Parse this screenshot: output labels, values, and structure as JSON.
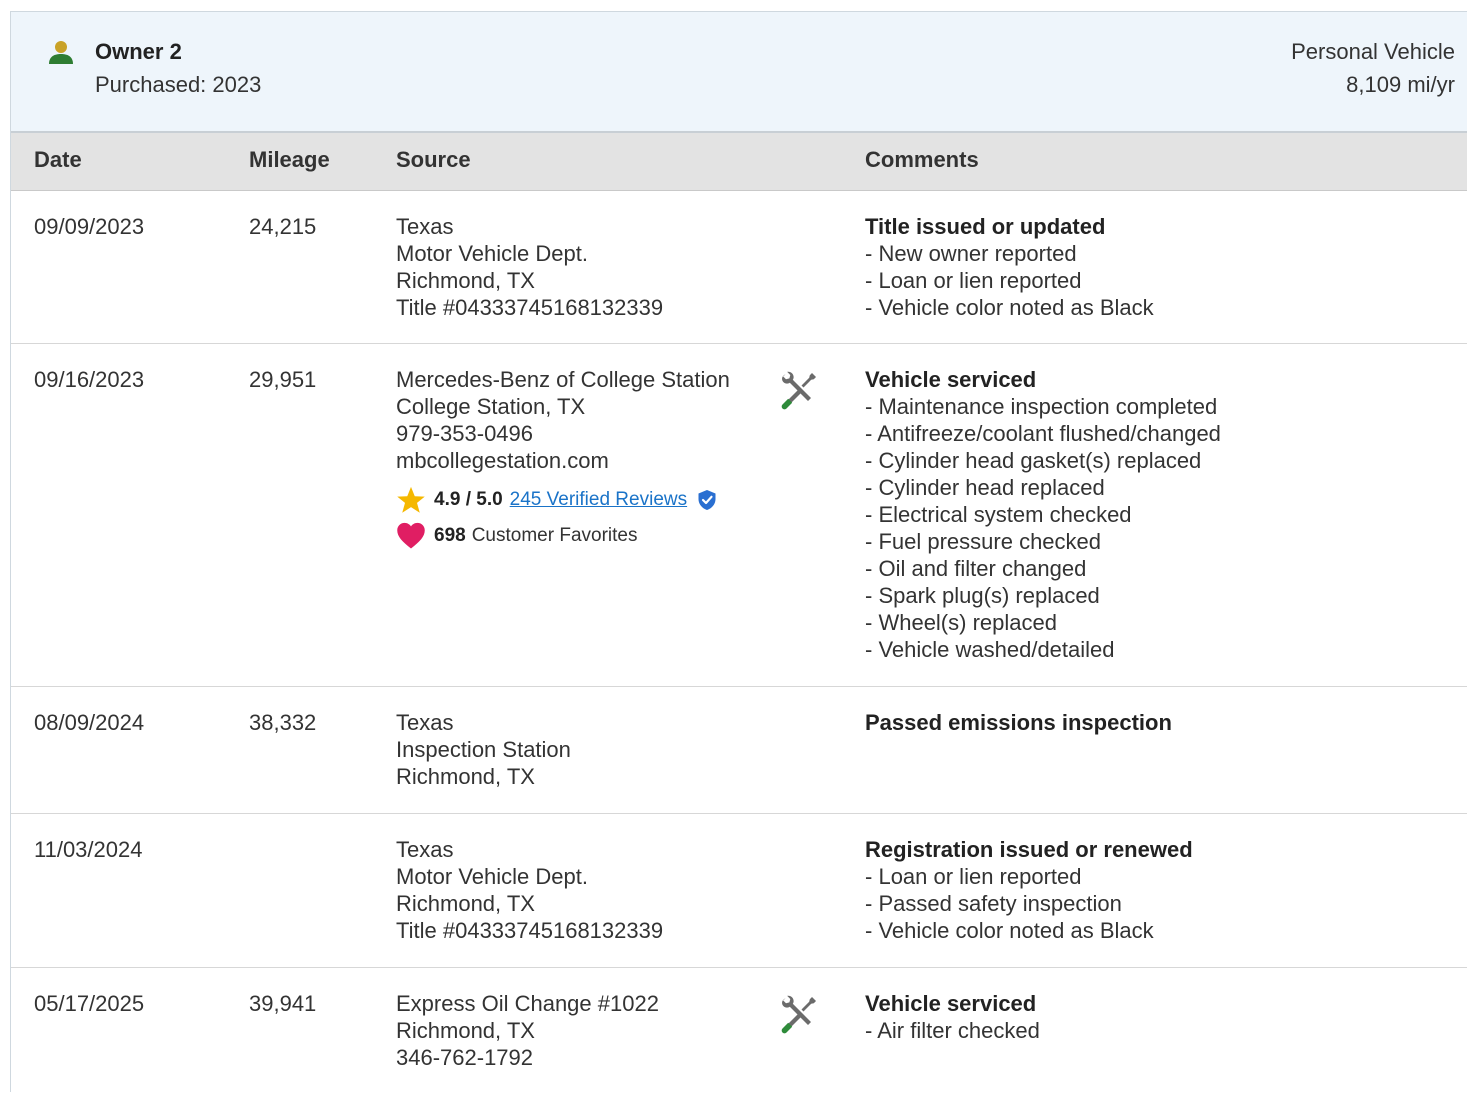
{
  "owner": {
    "name": "Owner 2",
    "purchased": "Purchased: 2023",
    "vehicle_type": "Personal Vehicle",
    "annual_miles": "8,109 mi/yr"
  },
  "columns": {
    "date": "Date",
    "mileage": "Mileage",
    "source": "Source",
    "comments": "Comments"
  },
  "records": [
    {
      "date": "09/09/2023",
      "mileage": "24,215",
      "source": [
        "Texas",
        "Motor Vehicle Dept.",
        "Richmond, TX",
        "Title #04333745168132339"
      ],
      "comment_title": "Title issued or updated",
      "comment_items": [
        "New owner reported",
        "Loan or lien reported",
        "Vehicle color noted as Black"
      ]
    },
    {
      "date": "09/16/2023",
      "mileage": "29,951",
      "source": [
        "Mercedes-Benz of College Station",
        "College Station, TX",
        "979-353-0496",
        "mbcollegestation.com"
      ],
      "rating": {
        "score": "4.9 / 5.0",
        "reviews_link": "245 Verified Reviews",
        "favorites_count": "698",
        "favorites_label": "Customer Favorites"
      },
      "comment_title": "Vehicle serviced",
      "comment_items": [
        "Maintenance inspection completed",
        "Antifreeze/coolant flushed/changed",
        "Cylinder head gasket(s) replaced",
        "Cylinder head replaced",
        "Electrical system checked",
        "Fuel pressure checked",
        "Oil and filter changed",
        "Spark plug(s) replaced",
        "Wheel(s) replaced",
        "Vehicle washed/detailed"
      ]
    },
    {
      "date": "08/09/2024",
      "mileage": "38,332",
      "source": [
        "Texas",
        "Inspection Station",
        "Richmond, TX"
      ],
      "comment_title": "Passed emissions inspection",
      "comment_items": []
    },
    {
      "date": "11/03/2024",
      "mileage": "",
      "source": [
        "Texas",
        "Motor Vehicle Dept.",
        "Richmond, TX",
        "Title #04333745168132339"
      ],
      "comment_title": "Registration issued or renewed",
      "comment_items": [
        "Loan or lien reported",
        "Passed safety inspection",
        "Vehicle color noted as Black"
      ]
    },
    {
      "date": "05/17/2025",
      "mileage": "39,941",
      "source": [
        "Express Oil Change #1022",
        "Richmond, TX",
        "346-762-1792"
      ],
      "comment_title": "Vehicle serviced",
      "comment_items": [
        "Air filter checked"
      ]
    }
  ],
  "icons": {
    "owner": "person-icon",
    "service": "wrench-screwdriver-icon",
    "rating": "star-icon",
    "verified": "shield-check-icon",
    "favorites": "heart-icon"
  },
  "colors": {
    "owner_icon": "#2e7d32",
    "owner_icon_head": "#c9a227",
    "header_bg": "#eef5fb",
    "table_head_bg": "#e3e3e3",
    "link": "#1a73c8",
    "star": "#f5b800",
    "heart": "#e01e63",
    "verified": "#2a6fd1"
  }
}
